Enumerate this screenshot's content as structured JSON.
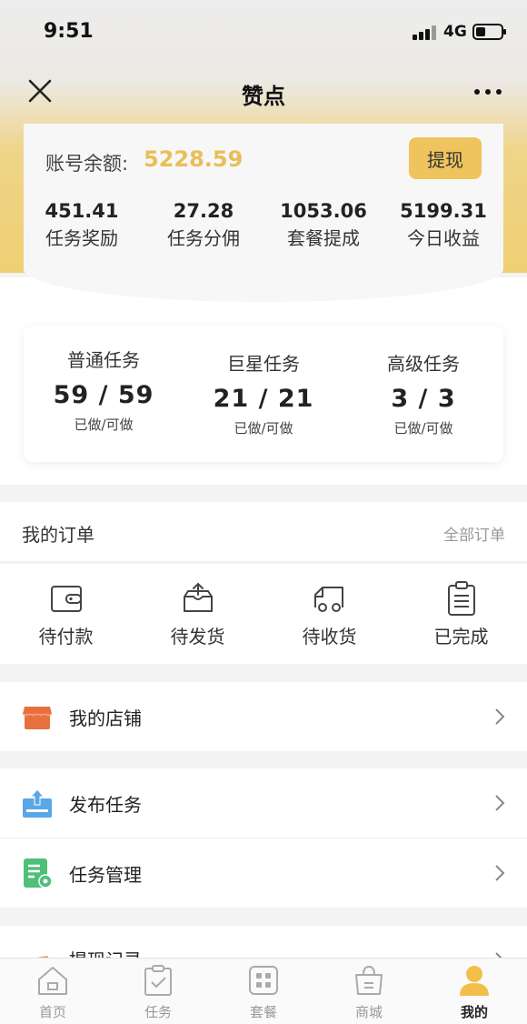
{
  "status": {
    "time": "9:51",
    "network": "4G"
  },
  "nav": {
    "title": "赞点"
  },
  "balance": {
    "label": "账号余额:",
    "value": "5228.59",
    "withdraw_label": "提现",
    "stats": [
      {
        "value": "451.41",
        "label": "任务奖励"
      },
      {
        "value": "27.28",
        "label": "任务分佣"
      },
      {
        "value": "1053.06",
        "label": "套餐提成"
      },
      {
        "value": "5199.31",
        "label": "今日收益"
      }
    ]
  },
  "tasks": [
    {
      "name": "普通任务",
      "count": "59 / 59",
      "sub": "已做/可做"
    },
    {
      "name": "巨星任务",
      "count": "21 / 21",
      "sub": "已做/可做"
    },
    {
      "name": "高级任务",
      "count": "3 / 3",
      "sub": "已做/可做"
    }
  ],
  "orders": {
    "title": "我的订单",
    "all_label": "全部订单",
    "items": [
      {
        "label": "待付款",
        "icon": "wallet-icon"
      },
      {
        "label": "待发货",
        "icon": "package-icon"
      },
      {
        "label": "待收货",
        "icon": "truck-icon"
      },
      {
        "label": "已完成",
        "icon": "clipboard-icon"
      }
    ]
  },
  "menu": {
    "store": {
      "label": "我的店铺",
      "icon": "store-icon"
    },
    "publish": {
      "label": "发布任务",
      "icon": "upload-icon"
    },
    "manage": {
      "label": "任务管理",
      "icon": "task-manage-icon"
    },
    "withdraw_record": {
      "label": "提现记录",
      "icon": "card-icon"
    }
  },
  "tabbar": [
    {
      "label": "首页",
      "icon": "home-icon"
    },
    {
      "label": "任务",
      "icon": "task-icon"
    },
    {
      "label": "套餐",
      "icon": "package-grid-icon"
    },
    {
      "label": "商城",
      "icon": "shop-bag-icon"
    },
    {
      "label": "我的",
      "icon": "user-icon",
      "active": true
    }
  ],
  "colors": {
    "accent": "#efc45e",
    "balance_value": "#e8bf57",
    "store_icon": "#e8703f",
    "publish_icon": "#5aa7e8",
    "manage_icon": "#4fbf7a",
    "user_icon": "#f2bf4a"
  }
}
